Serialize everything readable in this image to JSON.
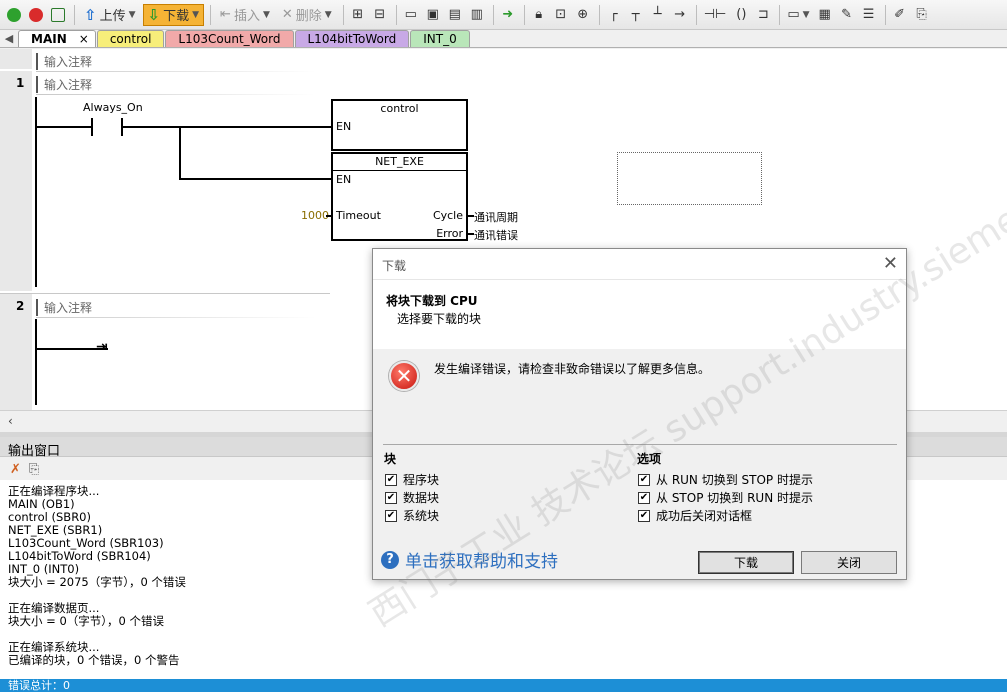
{
  "toolbar": {
    "upload_label": "上传",
    "download_label": "下载",
    "insert_label": "插入",
    "delete_label": "删除"
  },
  "tabs": [
    "MAIN",
    "control",
    "L103Count_Word",
    "L104bitToWord",
    "INT_0"
  ],
  "editor": {
    "comment_placeholder": "输入注释",
    "network1": {
      "number": "1",
      "comment": "输入注释",
      "contact_label": "Always_On",
      "box1": {
        "title": "control",
        "en": "EN"
      },
      "box2": {
        "title": "NET_EXE",
        "en": "EN",
        "timeout_pin": "Timeout",
        "timeout_value": "1000",
        "cycle_pin": "Cycle",
        "cycle_var": "通讯周期",
        "error_pin": "Error",
        "error_var": "通讯错误"
      }
    },
    "network2": {
      "number": "2",
      "comment": "输入注释"
    }
  },
  "output": {
    "title": "输出窗口",
    "lines": [
      "正在编译程序块...",
      "MAIN (OB1)",
      "control (SBR0)",
      "NET_EXE (SBR1)",
      "L103Count_Word (SBR103)",
      "L104bitToWord (SBR104)",
      "INT_0 (INT0)",
      "块大小 = 2075（字节），0 个错误",
      "",
      "正在编译数据页...",
      "块大小 = 0（字节），0 个错误",
      "",
      "正在编译系统块...",
      "已编译的块，0 个错误，0 个警告"
    ],
    "status": "错误总计：0"
  },
  "dialog": {
    "title": "下载",
    "heading": "将块下载到 CPU",
    "subheading": "选择要下载的块",
    "error_message": "发生编译错误，请检查非致命错误以了解更多信息。",
    "blocks_title": "块",
    "blocks": [
      "程序块",
      "数据块",
      "系统块"
    ],
    "options_title": "选项",
    "options": [
      "从 RUN 切换到 STOP 时提示",
      "从 STOP 切换到 RUN 时提示",
      "成功后关闭对话框"
    ],
    "help_text": "单击获取帮助和支持",
    "download_button": "下载",
    "close_button": "关闭"
  },
  "watermark": "西门子工业 技术论坛 support.industry.siemens.com/cs",
  "colors": {
    "download_active": "#f5b335",
    "status_bar": "#1d8fd6",
    "tab_control": "#f7ee7a",
    "tab_l103": "#f1a9a9",
    "tab_l104": "#c8a9e6",
    "tab_int0": "#b9e6b9"
  }
}
